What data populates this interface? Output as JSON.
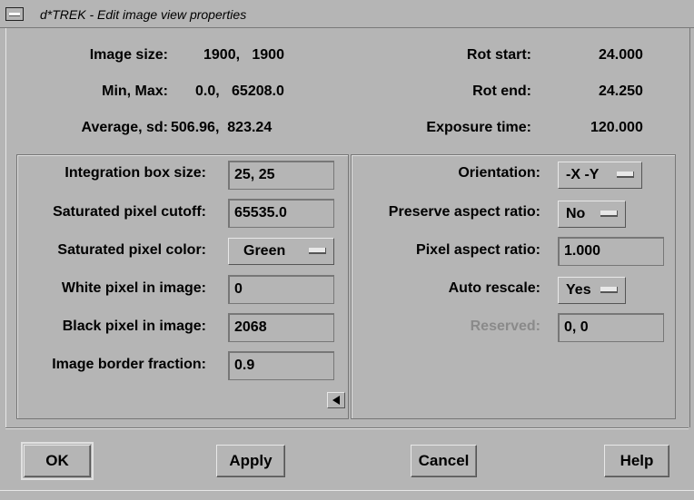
{
  "window": {
    "title": "d*TREK - Edit image view properties"
  },
  "info": {
    "image_size": {
      "label": "Image size:",
      "value": "1900,   1900"
    },
    "min_max": {
      "label": "Min, Max:",
      "value": "0.0,   65208.0"
    },
    "average_sd": {
      "label": "Average, sd:",
      "value": "506.96,  823.24"
    },
    "rot_start": {
      "label": "Rot start:",
      "value": "24.000"
    },
    "rot_end": {
      "label": "Rot end:",
      "value": "24.250"
    },
    "exposure_time": {
      "label": "Exposure time:",
      "value": "120.000"
    }
  },
  "left_panel": {
    "integration_box_size": {
      "label": "Integration box size:",
      "value": "25, 25"
    },
    "saturated_pixel_cutoff": {
      "label": "Saturated pixel cutoff:",
      "value": "65535.0"
    },
    "saturated_pixel_color": {
      "label": "Saturated pixel color:",
      "value": "Green"
    },
    "white_pixel": {
      "label": "White pixel in image:",
      "value": "0"
    },
    "black_pixel": {
      "label": "Black pixel in image:",
      "value": "2068"
    },
    "border_fraction": {
      "label": "Image border fraction:",
      "value": "0.9"
    }
  },
  "right_panel": {
    "orientation": {
      "label": "Orientation:",
      "value": "-X -Y"
    },
    "preserve_aspect": {
      "label": "Preserve aspect ratio:",
      "value": "No"
    },
    "pixel_aspect": {
      "label": "Pixel aspect ratio:",
      "value": "1.000"
    },
    "auto_rescale": {
      "label": "Auto rescale:",
      "value": "Yes"
    },
    "reserved": {
      "label": "Reserved:",
      "value": "0, 0"
    }
  },
  "buttons": {
    "ok": "OK",
    "apply": "Apply",
    "cancel": "Cancel",
    "help": "Help"
  }
}
